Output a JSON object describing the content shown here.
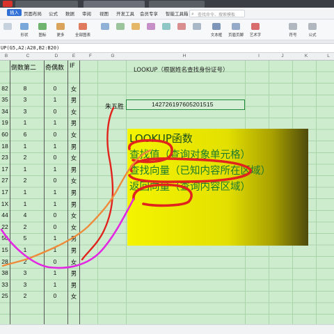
{
  "menu": {
    "items": [
      "页面布局",
      "公式",
      "数据",
      "审阅",
      "视图",
      "开发工具",
      "会员专享",
      "智能工具箱"
    ],
    "insert_tab": "插入",
    "search_placeholder": "查找命令、搜索模板"
  },
  "ribbon": {
    "buttons": [
      "",
      "形状",
      "图标",
      "更多",
      "全部图表",
      "",
      "",
      "",
      "",
      "",
      "",
      "",
      "文本框",
      "页眉页脚",
      "艺术字",
      "符号",
      "公式"
    ]
  },
  "formula_bar": {
    "text": "UP(G5,A2:A20,B2:B20)"
  },
  "columns": {
    "headers": [
      "B",
      "C",
      "D",
      "E",
      "F",
      "G",
      "H",
      "I",
      "J",
      "K",
      "L"
    ]
  },
  "table": {
    "header": {
      "col1": "倒数第二",
      "col2": "奇偶数",
      "col3": "IF"
    },
    "rows": [
      {
        "a": "82",
        "b": "8",
        "c": "0",
        "d": "女"
      },
      {
        "a": "35",
        "b": "3",
        "c": "1",
        "d": "男"
      },
      {
        "a": "34",
        "b": "3",
        "c": "0",
        "d": "女"
      },
      {
        "a": "19",
        "b": "1",
        "c": "1",
        "d": "男"
      },
      {
        "a": "60",
        "b": "6",
        "c": "0",
        "d": "女"
      },
      {
        "a": "18",
        "b": "1",
        "c": "1",
        "d": "男"
      },
      {
        "a": "23",
        "b": "2",
        "c": "0",
        "d": "女"
      },
      {
        "a": "17",
        "b": "1",
        "c": "1",
        "d": "男"
      },
      {
        "a": "27",
        "b": "2",
        "c": "0",
        "d": "女"
      },
      {
        "a": "17",
        "b": "1",
        "c": "1",
        "d": "男"
      },
      {
        "a": "1X",
        "b": "1",
        "c": "1",
        "d": "男"
      },
      {
        "a": "44",
        "b": "4",
        "c": "0",
        "d": "女"
      },
      {
        "a": "22",
        "b": "2",
        "c": "0",
        "d": "女"
      },
      {
        "a": "50",
        "b": "5",
        "c": "1",
        "d": "男"
      },
      {
        "a": "15",
        "b": "1",
        "c": "1",
        "d": "男"
      },
      {
        "a": "28",
        "b": "2",
        "c": "0",
        "d": "女"
      },
      {
        "a": "38",
        "b": "3",
        "c": "1",
        "d": "男"
      },
      {
        "a": "33",
        "b": "3",
        "c": "1",
        "d": "男"
      },
      {
        "a": "25",
        "b": "2",
        "c": "0",
        "d": "女"
      }
    ]
  },
  "lookup_title": "LOOKUP（根据姓名查找身份证号）",
  "name_label": "朱五胜",
  "id_value": "142726197605201515",
  "textbox": {
    "title": "LOOKUP函数",
    "line1": "查找值（查询对象单元格）",
    "line2": "查找向量（已知内容所在区域）",
    "line3": "返回向量（查询内容区域）"
  },
  "colors": {
    "sheet_bg": "#cdeccd",
    "accent_red": "#e0231c",
    "accent_orange": "#ee8a3a",
    "accent_magenta": "#e228e2",
    "textbox_text": "#1d7a2f"
  }
}
